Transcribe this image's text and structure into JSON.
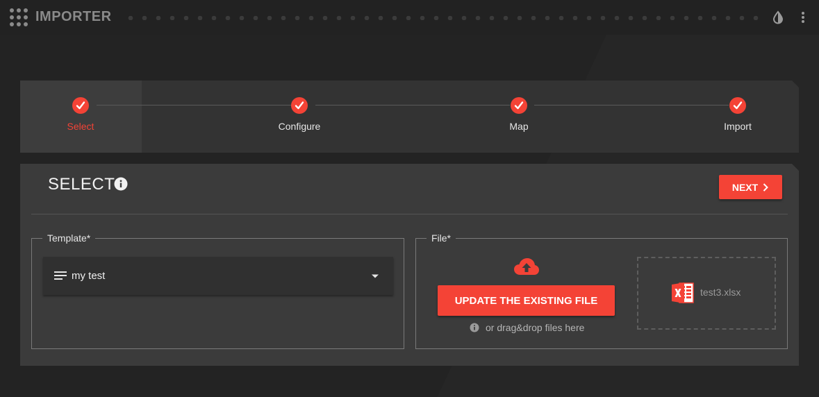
{
  "app": {
    "title": "IMPORTER",
    "icons": {
      "menu": "apps-grid-icon",
      "theme": "contrast-icon",
      "more": "more-vertical-icon"
    }
  },
  "colors": {
    "accent": "#f44336",
    "background": "#232323",
    "card": "#3b3b3b",
    "stepper": "#333333"
  },
  "stepper": {
    "steps": [
      {
        "label": "Select",
        "active": true,
        "completed": true
      },
      {
        "label": "Configure",
        "active": false,
        "completed": true
      },
      {
        "label": "Map",
        "active": false,
        "completed": true
      },
      {
        "label": "Import",
        "active": false,
        "completed": true
      }
    ]
  },
  "panel": {
    "title": "SELECT",
    "next_label": "NEXT",
    "template": {
      "legend": "Template*",
      "selected_value": "my test"
    },
    "file": {
      "legend": "File*",
      "update_label": "UPDATE THE EXISTING FILE",
      "drag_hint": "or drag&drop files here",
      "file_name": "test3.xlsx"
    }
  }
}
